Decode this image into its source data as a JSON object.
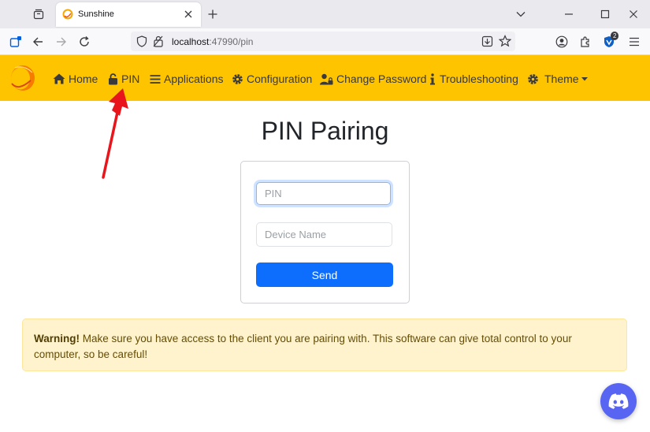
{
  "browser": {
    "tab_title": "Sunshine",
    "url_host": "localhost",
    "url_rest": ":47990/pin",
    "extension_badge": "2"
  },
  "app_nav": {
    "items": [
      {
        "label": "Home",
        "icon": "home-icon"
      },
      {
        "label": "PIN",
        "icon": "lock-icon"
      },
      {
        "label": "Applications",
        "icon": "list-icon"
      },
      {
        "label": "Configuration",
        "icon": "gear-icon"
      },
      {
        "label": "Change Password",
        "icon": "user-lock-icon"
      },
      {
        "label": "Troubleshooting",
        "icon": "info-icon"
      },
      {
        "label": "Theme",
        "icon": "gear-icon"
      }
    ]
  },
  "page": {
    "title": "PIN Pairing",
    "pin_placeholder": "PIN",
    "device_placeholder": "Device Name",
    "send_label": "Send",
    "warning_strong": "Warning!",
    "warning_text": " Make sure you have access to the client you are pairing with. This software can give total control to your computer, so be careful!"
  },
  "colors": {
    "nav_bg": "#ffc400",
    "primary": "#0d6efd",
    "warning_bg": "#fff3cd",
    "discord": "#5865f2",
    "annotation_arrow": "#e8161c"
  }
}
